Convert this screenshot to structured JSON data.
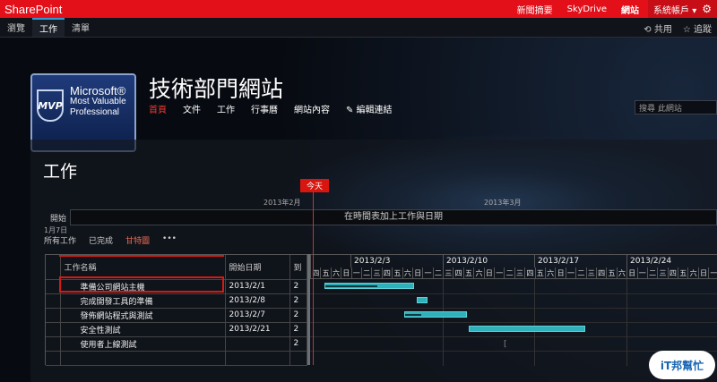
{
  "suitebar": {
    "brand": "SharePoint",
    "links": [
      "新聞摘要",
      "SkyDrive",
      "網站"
    ],
    "active_link": "網站",
    "account": "系統帳戶 ▾",
    "settings_icon": "gear-icon"
  },
  "ribbon": {
    "tabs": [
      "瀏覽",
      "工作",
      "清單"
    ],
    "active_tab": "工作",
    "share": "共用",
    "follow": "追蹤"
  },
  "site": {
    "logo_line1": "Microsoft®",
    "logo_line2": "Most Valuable",
    "logo_line3": "Professional",
    "logo_badge": "MVP",
    "title": "技術部門網站",
    "nav": [
      "首頁",
      "文件",
      "工作",
      "行事曆",
      "網站內容"
    ],
    "nav_active": "首頁",
    "edit_links": "✎ 編輯連結",
    "search_placeholder": "搜尋 此網站"
  },
  "page": {
    "title": "工作",
    "today_label": "今天",
    "month1": "2013年2月",
    "month2": "2013年3月",
    "timeline_start": "開始",
    "timeline_start_date": "1月7日",
    "timeline_empty": "在時間表加上工作與日期",
    "views": [
      "所有工作",
      "已完成",
      "甘特圖",
      "•••"
    ],
    "active_view": "甘特圖"
  },
  "grid": {
    "columns": [
      "",
      "工作名稱",
      "開始日期",
      "到"
    ],
    "rows": [
      {
        "name": "準備公司網站主機",
        "start": "2013/2/1",
        "due": "2"
      },
      {
        "name": "完成開發工具的準備",
        "start": "2013/2/8",
        "due": "2"
      },
      {
        "name": "發佈網站程式與測試",
        "start": "2013/2/7",
        "due": "2"
      },
      {
        "name": "安全性測試",
        "start": "2013/2/21",
        "due": "2"
      },
      {
        "name": "使用者上線測試",
        "start": "",
        "due": "2"
      },
      {
        "name": "",
        "start": "",
        "due": ""
      }
    ]
  },
  "gantt": {
    "weeks": [
      "",
      "2013/2/3",
      "2013/2/10",
      "2013/2/17",
      "2013/2/24"
    ],
    "days": [
      "四",
      "五",
      "六",
      "日",
      "一",
      "二",
      "三",
      "四",
      "五",
      "六",
      "日",
      "一",
      "二",
      "三",
      "四",
      "五",
      "六",
      "日",
      "一",
      "二",
      "三",
      "四",
      "五",
      "六",
      "日",
      "一",
      "二",
      "三",
      "四",
      "五",
      "六",
      "日",
      "一",
      "二",
      "三",
      "四",
      "五",
      "六",
      "日",
      "一"
    ],
    "bar_color": "#2fb1bb",
    "today_color": "#d8160f"
  },
  "watermark": "iT邦幫忙"
}
